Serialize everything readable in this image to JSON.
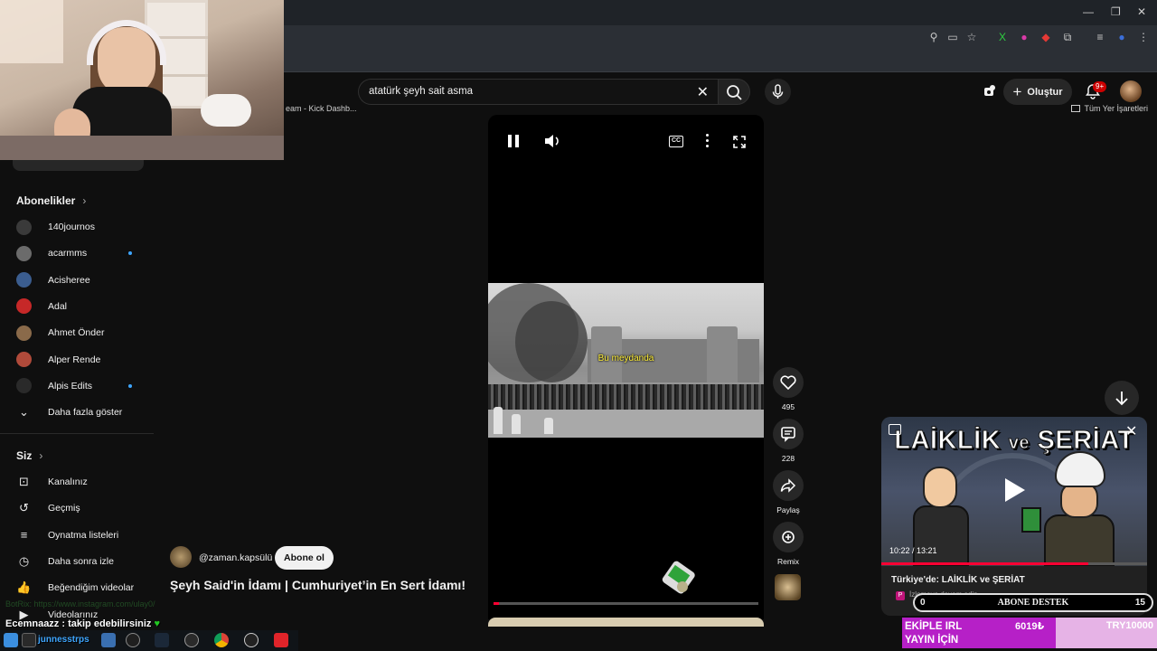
{
  "browser": {
    "bookmark_left": "eam - Kick Dashb...",
    "bookmark_right": "Tüm Yer İşaretleri"
  },
  "search": {
    "query": "atatürk şeyh sait asma"
  },
  "header": {
    "create_label": "Oluştur",
    "notification_badge": "9+"
  },
  "sidebar": {
    "subscriptions_title": "Abonelikler",
    "subscriptions": [
      {
        "name": "140journos",
        "color": "#3a3a3a",
        "dot": false
      },
      {
        "name": "acarmms",
        "color": "#6b6b6b",
        "dot": true
      },
      {
        "name": "Acisheree",
        "color": "#3b5d8f",
        "dot": false
      },
      {
        "name": "Adal",
        "color": "#c62828",
        "dot": false
      },
      {
        "name": "Ahmet Önder",
        "color": "#8a6a4a",
        "dot": false
      },
      {
        "name": "Alper Rende",
        "color": "#b04a3a",
        "dot": false
      },
      {
        "name": "Alpis Edits",
        "color": "#2a2a2a",
        "dot": true
      }
    ],
    "show_more": "Daha fazla göster",
    "you_title": "Siz",
    "you_items": [
      {
        "label": "Kanalınız",
        "icon": "channel-icon"
      },
      {
        "label": "Geçmiş",
        "icon": "history-icon"
      },
      {
        "label": "Oynatma listeleri",
        "icon": "playlists-icon"
      },
      {
        "label": "Daha sonra izle",
        "icon": "watch-later-icon"
      },
      {
        "label": "Beğendiğim videolar",
        "icon": "liked-icon"
      },
      {
        "label": "Videolarınız",
        "icon": "your-videos-icon"
      }
    ]
  },
  "short": {
    "subtitle": "Bu meydanda",
    "channel": "@zaman.kapsülü",
    "subscribe_label": "Abone ol",
    "title": "Şeyh Said'in İdamı | Cumhuriyet’in En Sert İdamı!",
    "progress_fraction": 0.02,
    "likes": "495",
    "comments": "228",
    "share_label": "Paylaş",
    "remix_label": "Remix"
  },
  "mini_player": {
    "headline_a": "LAİKLİK",
    "headline_ve": "ve",
    "headline_b": "ŞERİAT",
    "time": "10:22 / 13:21",
    "progress_fraction": 0.78,
    "title": "Türkiye'de: LAİKLİK ve ŞERİAT",
    "subtitle": "İzlemeye devam edin"
  },
  "overlay": {
    "abone_start": "0",
    "abone_label": "ABONE DESTEK",
    "abone_goal": "15",
    "ekiple_line1": "EKİPLE IRL",
    "ekiple_line2": "YAYIN İÇİN",
    "ekiple_amount": "6019₺",
    "ekiple_goal": "TRY10000",
    "ekiple_fraction": 0.6019,
    "chat_faded": "BotRix: https://www.instagram.com/ulay0/",
    "chat_main_user": "Ecemnaazz",
    "chat_main_text": ": takip edebilirsiniz",
    "taskbar_user": "junnesstrps"
  }
}
